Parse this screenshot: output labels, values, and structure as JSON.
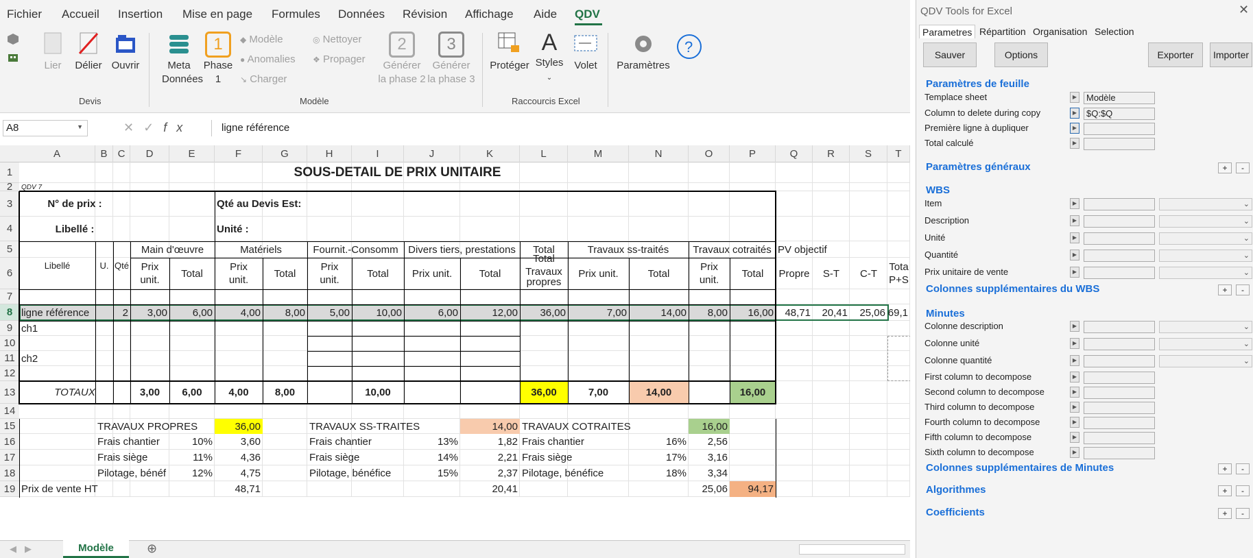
{
  "ribbon": {
    "tabs": [
      "Fichier",
      "Accueil",
      "Insertion",
      "Mise en page",
      "Formules",
      "Données",
      "Révision",
      "Affichage",
      "Aide",
      "QDV"
    ],
    "active_tab": "QDV",
    "devis": {
      "group": "Devis",
      "lier": "Lier",
      "delier": "Délier",
      "ouvrir": "Ouvrir"
    },
    "modele": {
      "group": "Modèle",
      "meta_line1": "Meta",
      "meta_line2": "Données",
      "phase1_line1": "Phase",
      "phase1_line2": "1",
      "phase1_num": "1",
      "modele": "Modèle",
      "anomalies": "Anomalies",
      "charger": "Charger",
      "nettoyer": "Nettoyer",
      "propager": "Propager",
      "gen2_num": "2",
      "gen2_line1": "Générer",
      "gen2_line2": "la phase 2",
      "gen3_num": "3",
      "gen3_line1": "Générer",
      "gen3_line2": "la phase 3"
    },
    "raccourcis": {
      "group": "Raccourcis Excel",
      "proteger": "Protéger",
      "styles": "Styles",
      "volet": "Volet"
    },
    "parametres": "Paramètres"
  },
  "formula": {
    "namebox": "A8",
    "fx": "fx",
    "value": "ligne référence"
  },
  "columns": [
    "A",
    "B",
    "C",
    "D",
    "E",
    "F",
    "G",
    "H",
    "I",
    "J",
    "K",
    "L",
    "M",
    "N",
    "O",
    "P",
    "Q",
    "R",
    "S",
    "T"
  ],
  "rows": [
    "1",
    "2",
    "3",
    "4",
    "5",
    "6",
    "7",
    "8",
    "9",
    "10",
    "11",
    "12",
    "13",
    "14",
    "15",
    "16",
    "17",
    "18",
    "19"
  ],
  "sheet": {
    "title": "SOUS-DETAIL DE PRIX UNITAIRE",
    "qdv7": "QDV 7",
    "no_prix": "N° de prix :",
    "qte_devis": "Qté au Devis Est:",
    "libelle_lbl": "Libellé :",
    "unite_lbl": "Unité :",
    "h5": {
      "main": "Main d'œuvre",
      "materiels": "Matériels",
      "fournit": "Fournit.-Consomm",
      "divers": "Divers tiers, prestations",
      "total": "Total",
      "ss_traites": "Travaux ss-traités",
      "cotraites": "Travaux cotraités",
      "pv": "PV objectif"
    },
    "h6": {
      "libelle": "Libellé",
      "u": "U.",
      "qte": "Qté",
      "prix_unit_a": "Prix",
      "prix_unit_b": "unit.",
      "total": "Total",
      "prix_unit": "Prix unit.",
      "trav_a": "Travaux",
      "trav_b": "propres",
      "propre": "Propre",
      "st": "S-T",
      "ct": "C-T",
      "tot_a": "Tota",
      "tot_b": "P+S"
    },
    "row8": [
      "ligne référence",
      "2",
      "3,00",
      "6,00",
      "4,00",
      "8,00",
      "5,00",
      "10,00",
      "6,00",
      "12,00",
      "36,00",
      "7,00",
      "14,00",
      "8,00",
      "16,00",
      "48,71",
      "20,41",
      "25,06",
      "69,1"
    ],
    "ch1": "ch1",
    "ch2": "ch2",
    "totaux": {
      "label": "TOTAUX",
      "d": "3,00",
      "e": "6,00",
      "f": "4,00",
      "g": "8,00",
      "i": "10,00",
      "l": "36,00",
      "m": "7,00",
      "n": "14,00",
      "p": "16,00"
    },
    "recap": {
      "tp": "TRAVAUX PROPRES",
      "tp_v": "36,00",
      "fc": "Frais chantier",
      "fs": "Frais siège",
      "pb": "Pilotage, bénéf",
      "pb2": "Pilotage, bénéfice",
      "tp_fc_p": "10%",
      "tp_fc": "3,60",
      "tp_fs_p": "11%",
      "tp_fs": "4,36",
      "tp_pb_p": "12%",
      "tp_pb": "4,75",
      "st": "TRAVAUX SS-TRAITES",
      "st_v": "14,00",
      "st_fc_p": "13%",
      "st_fc": "1,82",
      "st_fs_p": "14%",
      "st_fs": "2,21",
      "st_pb_p": "15%",
      "st_pb": "2,37",
      "ct": "TRAVAUX COTRAITES",
      "ct_v": "16,00",
      "ct_fc_p": "16%",
      "ct_fc": "2,56",
      "ct_fs_p": "17%",
      "ct_fs": "3,16",
      "ct_pb_p": "18%",
      "ct_pb": "3,34",
      "pv": "Prix de vente HT",
      "pv_tp": "48,71",
      "pv_st": "20,41",
      "pv_ct": "25,06",
      "pv_total": "94,17"
    }
  },
  "sheet_tab": "Modèle",
  "pane": {
    "title": "QDV Tools for Excel",
    "tabs": [
      "Parametres",
      "Répartition",
      "Organisation",
      "Selection"
    ],
    "buttons": {
      "sauver": "Sauver",
      "options": "Options",
      "exporter": "Exporter",
      "importer": "Importer"
    },
    "sec_feuille": "Paramètres de feuille",
    "template_sheet": "Templace sheet",
    "template_val": "Modèle",
    "col_delete": "Column to delete during copy",
    "col_delete_val": "$Q:$Q",
    "premiere_ligne": "Première ligne à dupliquer",
    "total_calc": "Total calculé",
    "sec_generaux": "Paramètres généraux",
    "sec_wbs": "WBS",
    "wbs": [
      "Item",
      "Description",
      "Unité",
      "Quantité",
      "Prix unitaire de vente"
    ],
    "sec_wbs_cols": "Colonnes supplémentaires du WBS",
    "sec_minutes": "Minutes",
    "minutes": [
      "Colonne description",
      "Colonne unité",
      "Colonne quantité"
    ],
    "decompose": [
      "First column to decompose",
      "Second column to decompose",
      "Third column to decompose",
      "Fourth column to decompose",
      "Fifth column to decompose",
      "Sixth column to decompose"
    ],
    "sec_min_cols": "Colonnes supplémentaires de Minutes",
    "sec_algo": "Algorithmes",
    "sec_coef": "Coefficients"
  },
  "colors": {
    "accent": "#217346",
    "yellow": "#ffff00",
    "peach": "#f8cbad",
    "green": "#a9d08e",
    "orange": "#f4b183",
    "link": "#1a6fd8"
  }
}
